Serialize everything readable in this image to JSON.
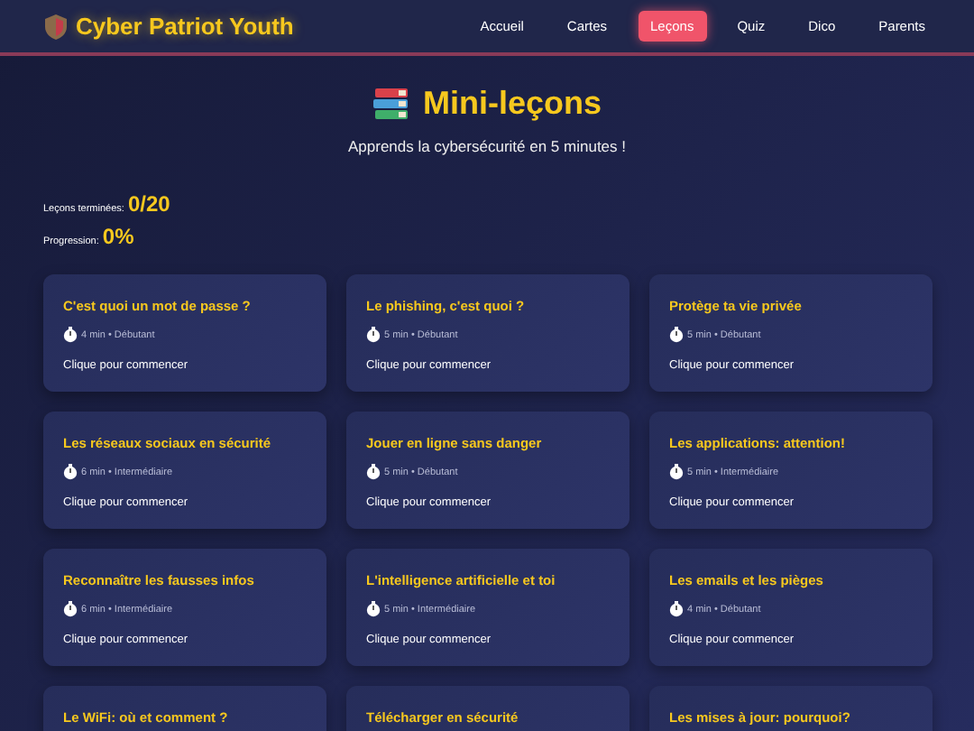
{
  "brand": "Cyber Patriot Youth",
  "nav": [
    {
      "label": "Accueil",
      "selected": false
    },
    {
      "label": "Cartes",
      "selected": false
    },
    {
      "label": "Leçons",
      "selected": true
    },
    {
      "label": "Quiz",
      "selected": false
    },
    {
      "label": "Dico",
      "selected": false
    },
    {
      "label": "Parents",
      "selected": false
    }
  ],
  "title": "Mini-leçons",
  "subtitle": "Apprends la cybersécurité en 5 minutes !",
  "stats": [
    {
      "label": "Leçons terminées:",
      "value": "0/20"
    },
    {
      "label": "Progression:",
      "value": "0%"
    }
  ],
  "lessons": [
    {
      "title": "C'est quoi un mot de passe ?",
      "meta": "4 min • Débutant",
      "cta": "Clique pour commencer"
    },
    {
      "title": "Le phishing, c'est quoi ?",
      "meta": "5 min • Débutant",
      "cta": "Clique pour commencer"
    },
    {
      "title": "Protège ta vie privée",
      "meta": "5 min • Débutant",
      "cta": "Clique pour commencer"
    },
    {
      "title": "Les réseaux sociaux en sécurité",
      "meta": "6 min • Intermédiaire",
      "cta": "Clique pour commencer"
    },
    {
      "title": "Jouer en ligne sans danger",
      "meta": "5 min • Débutant",
      "cta": "Clique pour commencer"
    },
    {
      "title": "Les applications: attention!",
      "meta": "5 min • Intermédiaire",
      "cta": "Clique pour commencer"
    },
    {
      "title": "Reconnaître les fausses infos",
      "meta": "6 min • Intermédiaire",
      "cta": "Clique pour commencer"
    },
    {
      "title": "L'intelligence artificielle et toi",
      "meta": "5 min • Intermédiaire",
      "cta": "Clique pour commencer"
    },
    {
      "title": "Les emails et les pièges",
      "meta": "4 min • Débutant",
      "cta": "Clique pour commencer"
    },
    {
      "title": "Le WiFi: où et comment ?"
    },
    {
      "title": "Télécharger en sécurité"
    },
    {
      "title": "Les mises à jour: pourquoi?"
    }
  ]
}
